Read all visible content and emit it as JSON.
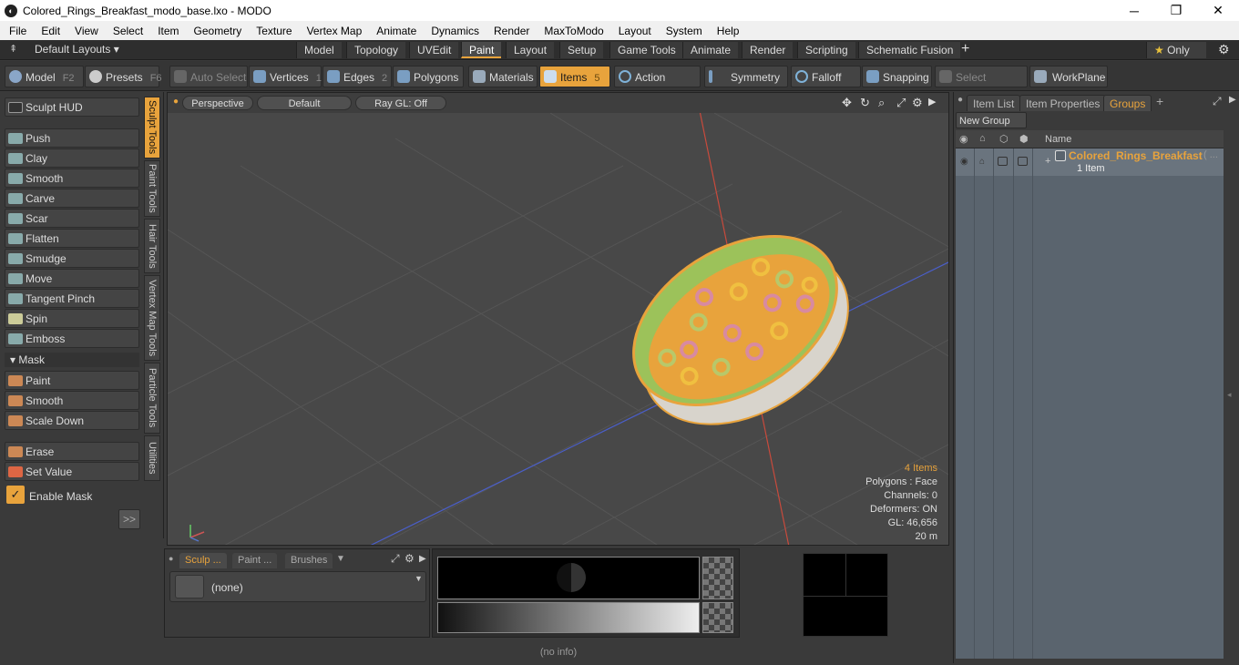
{
  "window": {
    "title": "Colored_Rings_Breakfast_modo_base.lxo - MODO",
    "minimize": "─",
    "maximize": "❐",
    "close": "✕"
  },
  "menu": [
    "File",
    "Edit",
    "View",
    "Select",
    "Item",
    "Geometry",
    "Texture",
    "Vertex Map",
    "Animate",
    "Dynamics",
    "Render",
    "MaxToModo",
    "Layout",
    "System",
    "Help"
  ],
  "layoutbar": {
    "default_layouts": "Default Layouts ▾",
    "tabs": [
      "Model",
      "Topology",
      "UVEdit",
      "Paint",
      "Layout",
      "Setup",
      "Game Tools",
      "Animate",
      "Render",
      "Scripting",
      "Schematic Fusion"
    ],
    "active_tab": "Paint",
    "add": "+",
    "only": "★ Only",
    "gear": "⚙"
  },
  "toolbar": {
    "model": "Model",
    "model_hk": "F2",
    "presets": "Presets",
    "presets_hk": "F6",
    "auto_select": "Auto Select",
    "vertices": "Vertices",
    "vertices_hk": "1",
    "edges": "Edges",
    "edges_hk": "2",
    "polygons": "Polygons",
    "materials": "Materials",
    "items": "Items",
    "items_hk": "5",
    "action_center": "Action Center",
    "symmetry": "Symmetry",
    "falloff": "Falloff",
    "snapping": "Snapping",
    "select_through": "Select Through",
    "workplane": "WorkPlane"
  },
  "sculpt": {
    "hud": "Sculpt HUD",
    "tools": [
      "Push",
      "Clay",
      "Smooth",
      "Carve",
      "Scar",
      "Flatten",
      "Smudge",
      "Move",
      "Tangent Pinch",
      "Spin",
      "Emboss"
    ],
    "mask_header": "Mask",
    "mask_tools": [
      "Paint",
      "Smooth",
      "Scale Down"
    ],
    "erase": "Erase",
    "set_value": "Set Value",
    "enable_mask": "Enable Mask",
    "expand": ">>"
  },
  "vtabs": [
    "Sculpt Tools",
    "Paint Tools",
    "Hair Tools",
    "Vertex Map Tools",
    "Particle Tools",
    "Utilities"
  ],
  "viewport": {
    "perspective": "Perspective",
    "default": "Default",
    "raygl": "Ray GL: Off",
    "stats": {
      "items": "4 Items",
      "polygons": "Polygons : Face",
      "channels": "Channels: 0",
      "deformers": "Deformers: ON",
      "gl": "GL: 46,656",
      "distance": "20 m"
    }
  },
  "bottom": {
    "tabs": [
      "Sculp ...",
      "Paint ...",
      "Brushes"
    ],
    "brush_value": "(none)",
    "status": "(no info)"
  },
  "rightpanel": {
    "tabs": [
      "Item List",
      "Item Properties",
      "Groups"
    ],
    "active": "Groups",
    "new_group": "New Group",
    "name_header": "Name",
    "group_name": "Colored_Rings_Breakfast",
    "group_suffix": "( ...",
    "group_count": "1 Item"
  },
  "colors": {
    "accent": "#e8a33c",
    "bg": "#3a3a3a",
    "viewport": "#484848"
  }
}
